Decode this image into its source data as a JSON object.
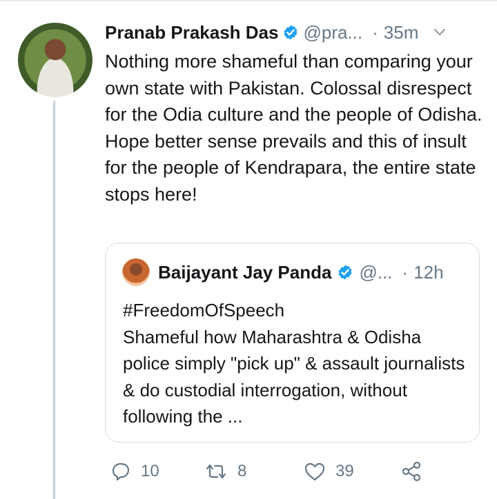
{
  "tweet": {
    "author_name": "Pranab Prakash Das",
    "handle": "@pra...",
    "separator": "·",
    "time": "35m",
    "text": "Nothing more shameful than comparing your own state with Pakistan. Colossal disrespect for the Odia culture and the people of Odisha. Hope better sense prevails and this of insult for the people of Kendrapara, the entire state stops here!"
  },
  "quoted_tweet": {
    "author_name": "Baijayant Jay Panda",
    "handle": "@...",
    "separator": "·",
    "time": "12h",
    "text": "#FreedomOfSpeech\nShameful how Maharashtra & Odisha police simply \"pick up\" & assault journalists & do custodial interrogation, without following the ..."
  },
  "actions": {
    "replies": "10",
    "retweets": "8",
    "likes": "39"
  },
  "colors": {
    "text": "#14171a",
    "secondary": "#657786",
    "verified": "#1da1f2",
    "divider": "#e6ecf0"
  },
  "icons": [
    "verified-badge-icon",
    "chevron-down-icon",
    "reply-icon",
    "retweet-icon",
    "like-icon",
    "share-icon"
  ]
}
